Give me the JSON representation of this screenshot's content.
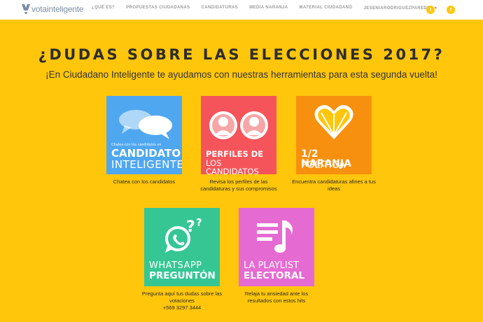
{
  "brand": {
    "name": "votainteligente"
  },
  "nav": {
    "items": [
      "¿QUÉ ES?",
      "PROPUESTAS CIUDADANAS",
      "CANDIDATURAS",
      "MEDIA NARANJA",
      "MATERIAL CIUDADANO"
    ],
    "user": "JESENIARODRIGUEZPAREDES",
    "social": {
      "twitter": "t",
      "facebook": "f"
    }
  },
  "hero": {
    "headline": "¿DUDAS SOBRE LAS ELECCIONES 2017?",
    "subtitle": "¡En Ciudadano Inteligente te ayudamos con nuestras herramientas para esta segunda vuelta!"
  },
  "tools": [
    {
      "top_text": "Chatea con los candidatos en",
      "title_1": "CANDIDATO",
      "title_2": "INTELIGENTE",
      "caption": "Chatea con los candidatos",
      "color": "#4fa7f0"
    },
    {
      "title_1": "PERFILES DE",
      "title_2": "LOS CANDIDATOS",
      "caption": "Revisa los perfiles de las candidaturas y sus compromisos",
      "color": "#f5555a"
    },
    {
      "title_1": "1/2 NARANJA",
      "title_2": "POLÍTICA",
      "caption": "Encuentra candidaturas afines a tus ideas",
      "color": "#f7900f"
    },
    {
      "title_1": "WHATSAPP",
      "title_2": "PREGUNTÓN",
      "caption": "Pregunta aquí tus dudas sobre las votaciones",
      "phone": "+569 3297 3444",
      "color": "#35c694"
    },
    {
      "title_1": "LA PLAYLIST",
      "title_2": "ELECTORAL",
      "caption": "Relaja tu ansiedad ante los resultados con estos hits",
      "color": "#e56bd2"
    }
  ]
}
